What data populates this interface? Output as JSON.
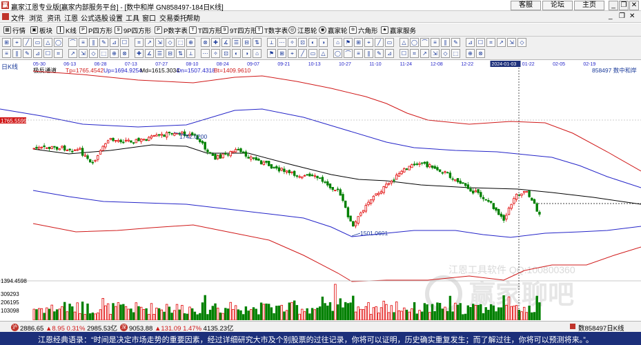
{
  "window": {
    "title": "赢家江恩专业版[赢家内部服务平台] - [数中和岸  GN858497-184日K线]",
    "app_icon": "ying-icon",
    "links": [
      "客服",
      "论坛",
      "主页"
    ]
  },
  "menu": [
    "文件",
    "浏览",
    "资讯",
    "江恩",
    "公式选股",
    "设置",
    "工具",
    "窗口",
    "交易委托",
    "帮助"
  ],
  "toolbar": [
    {
      "label": "行情",
      "icon": "grid-icon"
    },
    {
      "label": "板块",
      "icon": "block-icon"
    },
    {
      "label": "K线",
      "icon": "kline-icon"
    },
    {
      "label": "P四方形",
      "icon": "p-square-icon"
    },
    {
      "label": "9P四方形",
      "icon": "9p-square-icon"
    },
    {
      "label": "P数字表",
      "icon": "p-table-icon"
    },
    {
      "label": "T四方形",
      "icon": "t-square-icon"
    },
    {
      "label": "9T四方形",
      "icon": "9t-square-icon"
    },
    {
      "label": "T数字表",
      "icon": "t-table-icon"
    },
    {
      "label": "江恩轮",
      "icon": "gann-wheel-icon"
    },
    {
      "label": "赢家轮",
      "icon": "winner-wheel-icon"
    },
    {
      "label": "六角形",
      "icon": "hexagon-icon"
    },
    {
      "label": "赢家服务",
      "icon": "service-icon"
    }
  ],
  "chart": {
    "period_label": "日K线",
    "dates": [
      "05-30",
      "06-13",
      "06-28",
      "07-13",
      "07-27",
      "08-10",
      "08-24",
      "09-07",
      "09-21",
      "10-13",
      "10-27",
      "11-10",
      "11-24",
      "12-08",
      "12-22",
      "2024-01-03",
      "01-22",
      "02-05",
      "02-19"
    ],
    "indicator_name": "极反通道",
    "tp_label": "Tp=1765.4542",
    "up_label": "Up=1694.9254",
    "md_label": "Md=1615.3034",
    "dn_label": "Dn=1507.4318",
    "bt_label": "Bt=1409.9610",
    "code_label": "858497  数中和岸",
    "y_top_label": "1765.5599",
    "y_bottom_label": "1394.4598",
    "high_label": "1742.0200",
    "low_label": "1501.0601",
    "vol_labels": [
      "309293",
      "206195",
      "103098"
    ],
    "watermark_line1": "江恩工具软件 QQ:100800360",
    "watermark_line2": "赢家聊吧",
    "watermark_line3": "yingjia.yiz.cn",
    "colors": {
      "up": "#e00000",
      "down": "#008000",
      "top_band": "#d01818",
      "mid_band": "#2323c8",
      "median": "#000000"
    }
  },
  "statusbar": {
    "idx1_value": "2886.65",
    "idx1_change": "▲8.95",
    "idx1_pct": "0.31%",
    "idx1_amt": "2985.53亿",
    "idx2_value": "9053.88",
    "idx2_change": "▲131.09",
    "idx2_pct": "1.47%",
    "idx2_amt": "4135.23亿",
    "right_label": "数858497日K线"
  },
  "quote_bar": {
    "text": "江恩经典语录：“时间是决定市场走势的重要因素，经过详细研究大市及个别股票的过往记录，你将可以证明，历史确实重复发生；而了解过往，你将可以预测将来。”。"
  }
}
